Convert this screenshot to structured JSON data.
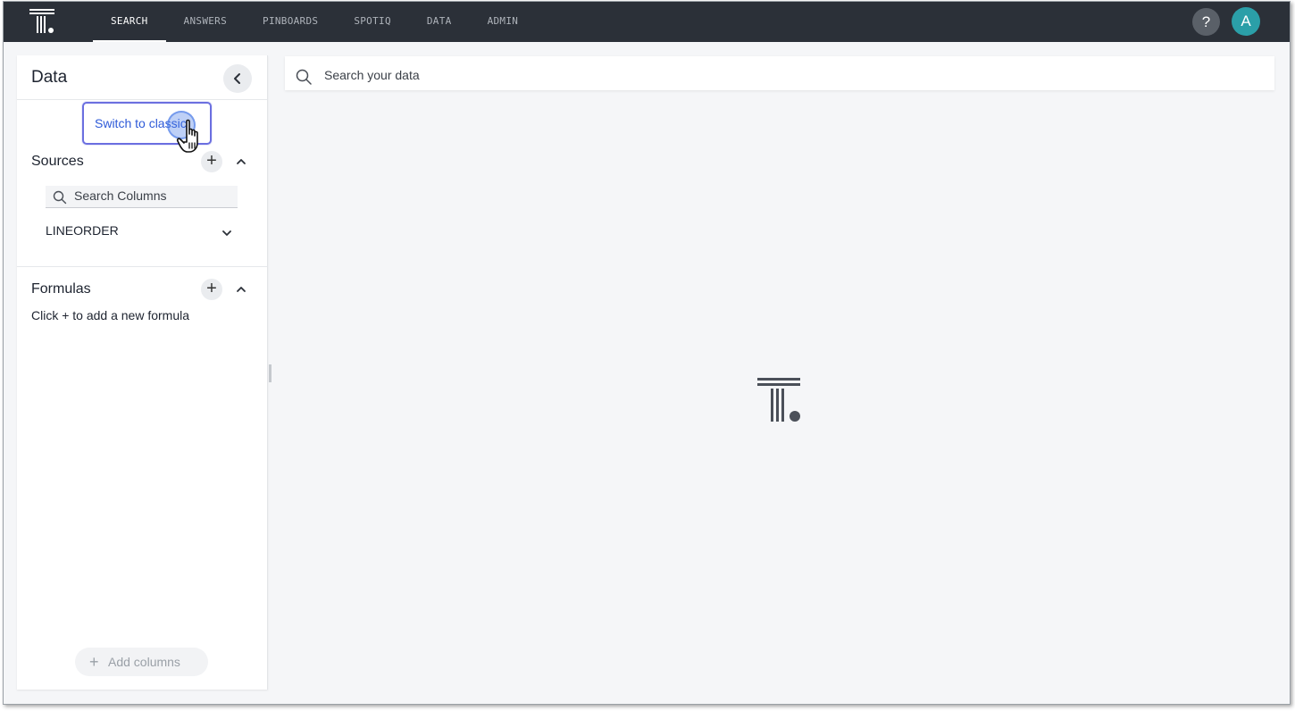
{
  "nav": {
    "items": [
      {
        "label": "SEARCH",
        "active": true
      },
      {
        "label": "ANSWERS",
        "active": false
      },
      {
        "label": "PINBOARDS",
        "active": false
      },
      {
        "label": "SPOTIQ",
        "active": false
      },
      {
        "label": "DATA",
        "active": false
      },
      {
        "label": "ADMIN",
        "active": false
      }
    ],
    "help_label": "?",
    "avatar_label": "A"
  },
  "panel": {
    "title": "Data",
    "switch_label": "Switch to classic",
    "sources": {
      "title": "Sources",
      "search_placeholder": "Search Columns",
      "items": [
        "LINEORDER"
      ]
    },
    "formulas": {
      "title": "Formulas",
      "hint": "Click + to add a new formula"
    },
    "add_columns_label": "Add columns",
    "add_icon_glyph": "+"
  },
  "search": {
    "placeholder": "Search your data"
  },
  "colors": {
    "topbar": "#2b3038",
    "accent": "#2e5ad8",
    "avatar": "#2b9fa8",
    "focus_ring": "#6b6fe0"
  },
  "icons": [
    "thoughtspot-logo-icon",
    "help-icon",
    "chevron-left-icon",
    "plus-icon",
    "chevron-up-icon",
    "search-icon",
    "chevron-down-icon",
    "hand-cursor-icon"
  ]
}
